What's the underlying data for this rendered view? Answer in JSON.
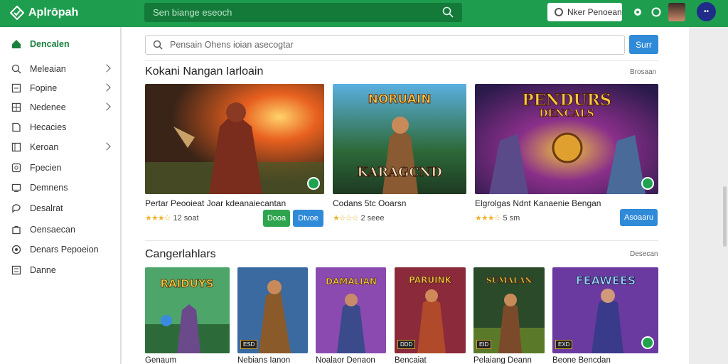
{
  "app": {
    "name": "Aplrōpah"
  },
  "header": {
    "search_placeholder": "Sen biange eseoch",
    "action_label": "Nker Penoean",
    "avatar_initials": "••"
  },
  "sidebar": {
    "items": [
      {
        "label": "Dencalen",
        "icon": "home-icon"
      },
      {
        "label": "Meleaian",
        "icon": "search-icon"
      },
      {
        "label": "Fopine",
        "icon": "square-icon"
      },
      {
        "label": "Nedenee",
        "icon": "grid-icon"
      },
      {
        "label": "Hecacies",
        "icon": "document-icon"
      },
      {
        "label": "Keroan",
        "icon": "columns-icon"
      },
      {
        "label": "Fpecien",
        "icon": "gear-square-icon"
      },
      {
        "label": "Demnens",
        "icon": "monitor-icon"
      },
      {
        "label": "Desalrat",
        "icon": "chat-icon"
      },
      {
        "label": "Oensaecan",
        "icon": "bag-icon"
      },
      {
        "label": "Denars Pepoeion",
        "icon": "circle-icon"
      },
      {
        "label": "Danne",
        "icon": "list-icon"
      }
    ]
  },
  "main": {
    "search_placeholder": "Pensain Ohens ioian asecogtar",
    "search_button": "Surr",
    "section1": {
      "title": "Kokani Nangan Iarloain",
      "see_all": "Brosaan",
      "cards": [
        {
          "title": "Pertar Peooieat Joar kdeanaiecantan",
          "rating_text": "12 soat",
          "btn1": "Dooa",
          "btn2": "Dtvoe"
        },
        {
          "title": "Codans 5tc Ooarsn",
          "rating_text": "2 seee",
          "art_title": "NORUAIN",
          "art_sub": "KARAGCND"
        },
        {
          "title": "Elgrolgas Ndnt Kanaenie Bengan",
          "rating_text": "5 sm",
          "btn": "Asoaaru",
          "art_title": "PENDURS",
          "art_sub": "DENCALS"
        }
      ]
    },
    "section2": {
      "title": "Cangerlahlars",
      "see_all": "Desecan",
      "cards": [
        {
          "title": "Genaum",
          "art_title": "RAIDUYS"
        },
        {
          "title": "Nebians Ianon",
          "tag": "ESD"
        },
        {
          "title": "Noalaor Denaon",
          "art_title": "DAMALIAN"
        },
        {
          "title": "Bencaiat",
          "art_title": "PARUINK",
          "tag": "DDD"
        },
        {
          "title": "Pelaiang Deann",
          "art_title": "SUMALAN",
          "tag": "EID"
        },
        {
          "title": "Beone Bencdan",
          "art_title": "FEAWEES",
          "tag": "EXD"
        }
      ]
    }
  },
  "colors": {
    "brand": "#1f9d4f",
    "accent_blue": "#2f8ad8",
    "star": "#f0b32d"
  }
}
